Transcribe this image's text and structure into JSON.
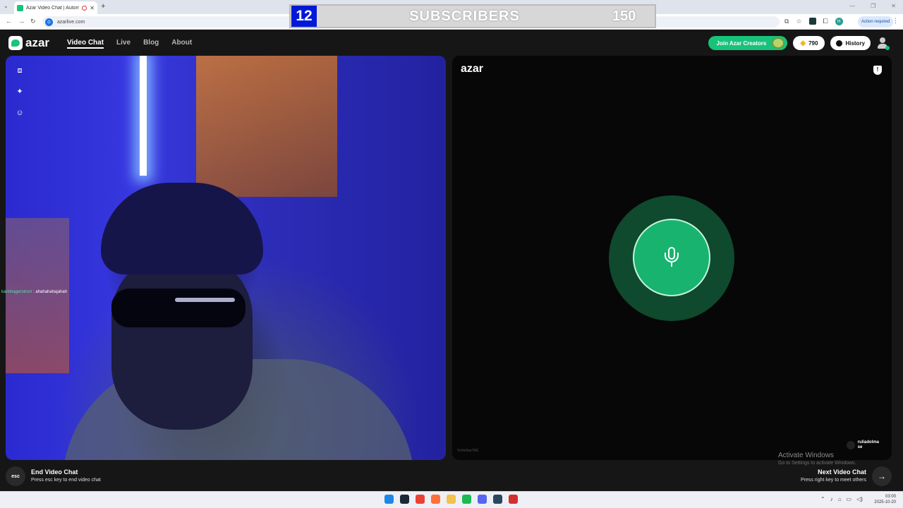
{
  "browser": {
    "tab_title": "Azar Video Chat | Automati",
    "url": "azarlive.com",
    "action_required": "Action required",
    "profile_initial": "H"
  },
  "overlay": {
    "count": "12",
    "label": "SUBSCRIBERS",
    "goal": "150"
  },
  "header": {
    "logo": "azar",
    "nav": [
      "Video Chat",
      "Live",
      "Blog",
      "About"
    ],
    "join_label": "Join Azar Creators",
    "gems": "790",
    "history_label": "History"
  },
  "self_video": {
    "chat_user": "karinhagerstrom",
    "chat_message": ": ahahahahajahah"
  },
  "partner": {
    "logo": "azar",
    "watermark": "YoYoOneT8S",
    "name": "ruliadolma",
    "country": "se"
  },
  "windows": {
    "activate_title": "Activate Windows",
    "activate_sub": "Go to Settings to activate Windows."
  },
  "footer": {
    "esc_key": "esc",
    "end_title": "End Video Chat",
    "end_sub": "Press esc key to end video chat",
    "next_title": "Next Video Chat",
    "next_sub": "Press right key to meet others"
  },
  "taskbar": {
    "time": "03:00",
    "date": "2025-10-20",
    "apps": [
      {
        "name": "windows-start-icon",
        "color": "#1e88e5"
      },
      {
        "name": "steam-icon",
        "color": "#1b2838"
      },
      {
        "name": "chrome-icon",
        "color": "#e94235"
      },
      {
        "name": "firefox-icon",
        "color": "#ff7139"
      },
      {
        "name": "file-explorer-icon",
        "color": "#f2c14e"
      },
      {
        "name": "spotify-icon",
        "color": "#1db954"
      },
      {
        "name": "discord-icon",
        "color": "#5865f2"
      },
      {
        "name": "steam-icon-2",
        "color": "#2a475e"
      },
      {
        "name": "recording-app-icon",
        "color": "#d32f2f"
      }
    ]
  },
  "colors": {
    "accent": "#18c27a",
    "mic_outer": "#0f4a2e",
    "mic_inner": "#18b36e",
    "overlay_count_bg": "#0018d8"
  }
}
